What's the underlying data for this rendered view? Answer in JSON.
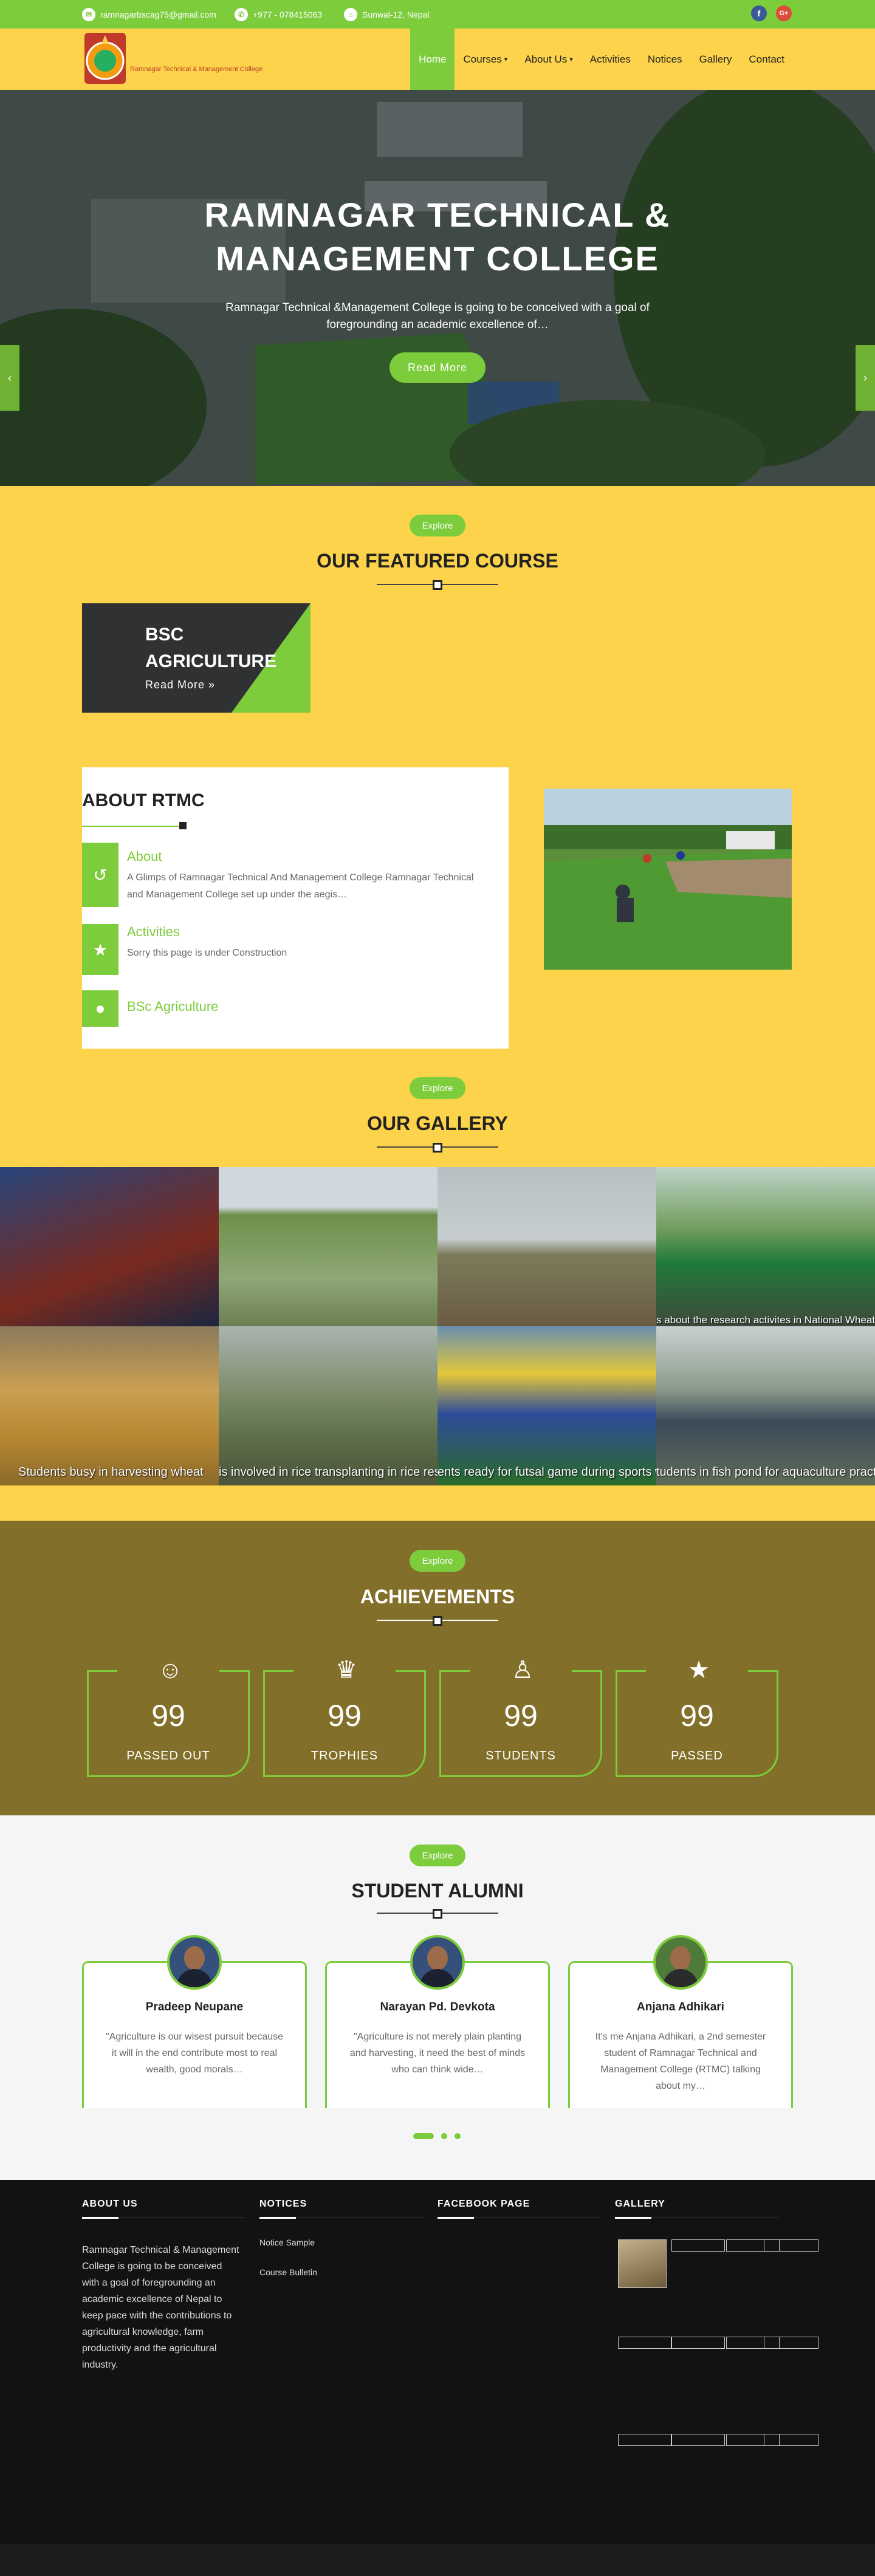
{
  "topbar": {
    "email": "ramnagarbscag75@gmail.com",
    "phone": "+977 - 078415063",
    "location": "Sunwal-12, Nepal",
    "social": [
      {
        "icon": "facebook-icon",
        "glyph": "f",
        "color": "#3b5998"
      },
      {
        "icon": "google-plus-icon",
        "glyph": "G+",
        "color": "#dd4b39"
      }
    ]
  },
  "header": {
    "logo_text": "Ramnagar Technical & Management College",
    "nav": [
      {
        "label": "Home",
        "active": true,
        "dropdown": false
      },
      {
        "label": "Courses",
        "active": false,
        "dropdown": true
      },
      {
        "label": "About Us",
        "active": false,
        "dropdown": true
      },
      {
        "label": "Activities",
        "active": false,
        "dropdown": false
      },
      {
        "label": "Notices",
        "active": false,
        "dropdown": false
      },
      {
        "label": "Gallery",
        "active": false,
        "dropdown": false
      },
      {
        "label": "Contact",
        "active": false,
        "dropdown": false
      }
    ]
  },
  "hero": {
    "title_line1": "RAMNAGAR TECHNICAL &",
    "title_line2": "MANAGEMENT COLLEGE",
    "subtitle_line1": "Ramnagar Technical &Management College is going to be conceived with a goal of",
    "subtitle_line2": "foregrounding an academic excellence of…",
    "button": "Read More",
    "prev": "‹",
    "next": "›"
  },
  "featured": {
    "pill": "Explore",
    "title": "OUR FEATURED COURSE",
    "course_line1": "BSC",
    "course_line2": "AGRICULTURE",
    "read_more": "Read More »"
  },
  "about": {
    "title": "ABOUT RTMC",
    "items": [
      {
        "title": "About",
        "text_line1": "A Glimps of Ramnagar Technical And Management College Ramnagar Technical",
        "text_line2": "and Management College set up under the aegis…",
        "icon": "history-icon",
        "glyph": "↺"
      },
      {
        "title": "Activities",
        "text_line1": "Sorry this page is under Construction",
        "text_line2": "",
        "icon": "star-icon",
        "glyph": "★"
      },
      {
        "title": "BSc Agriculture",
        "text_line1": "",
        "text_line2": "",
        "icon": "user-icon",
        "glyph": "●"
      }
    ]
  },
  "gallery": {
    "pill": "Explore",
    "title": "OUR GALLERY",
    "captions": [
      "",
      "",
      "",
      "s about the research activites in National Wheat Research Prog",
      "Students busy in harvesting wheat",
      "is involved in rice transplanting in rice research",
      "ents ready for futsal game during sports we",
      "tudents in fish pond for aquaculture practica"
    ]
  },
  "achievements": {
    "pill": "Explore",
    "title": "ACHIEVEMENTS",
    "items": [
      {
        "value": "99",
        "label": "PASSED OUT",
        "icon": "child-icon",
        "glyph": "☺"
      },
      {
        "value": "99",
        "label": "TROPHIES",
        "icon": "trophy-icon",
        "glyph": "♛"
      },
      {
        "value": "99",
        "label": "STUDENTS",
        "icon": "user-outline-icon",
        "glyph": "♙"
      },
      {
        "value": "99",
        "label": "PASSED",
        "icon": "star-icon",
        "glyph": "★"
      }
    ]
  },
  "alumni": {
    "pill": "Explore",
    "title": "STUDENT ALUMNI",
    "items": [
      {
        "name": "Pradeep Neupane",
        "l1": "\"Agriculture is our wisest pursuit because",
        "l2": "it will in the end contribute most to real",
        "l3": "wealth, good morals…",
        "l4": ""
      },
      {
        "name": "Narayan Pd. Devkota",
        "l1": "\"Agriculture is not merely plain planting",
        "l2": "and harvesting, it need the best of minds",
        "l3": "who can think wide…",
        "l4": ""
      },
      {
        "name": "Anjana Adhikari",
        "l1": "It's me Anjana Adhikari, a 2nd semester",
        "l2": "student of Ramnagar Technical and",
        "l3": "Management College (RTMC) talking",
        "l4": "about my…"
      }
    ]
  },
  "footer": {
    "about_title": "ABOUT US",
    "about_text": "Ramnagar Technical & Management College is going to be conceived with a goal of foregrounding an academic excellence of Nepal to keep pace with the contributions to agricultural knowledge, farm productivity and the agricultural industry.",
    "notices_title": "NOTICES",
    "notices": [
      "Notice Sample",
      "Course Bulletin"
    ],
    "facebook_title": "FACEBOOK PAGE",
    "gallery_title": "GALLERY"
  },
  "colors": {
    "green": "#7ccc3c",
    "yellow": "#fcd34a",
    "olive": "#82702a",
    "dark": "#121212"
  }
}
